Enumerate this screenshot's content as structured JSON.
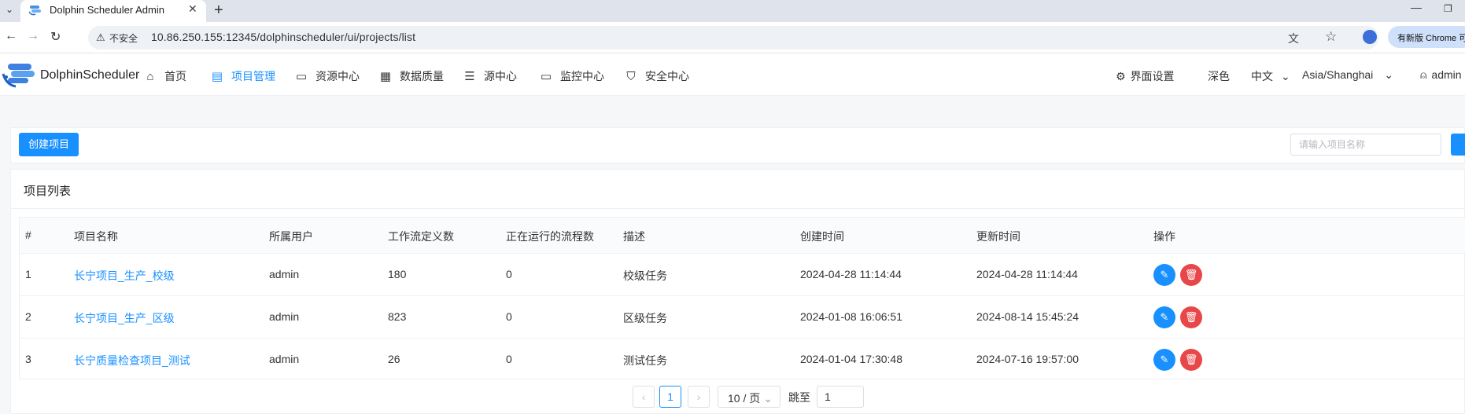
{
  "browser": {
    "tab_title": "Dolphin Scheduler Admin",
    "insecure_label": "不安全",
    "url": "10.86.250.155:12345/dolphinscheduler/ui/projects/list",
    "update_label": "有新版 Chrome 可"
  },
  "header": {
    "logo_text": "DolphinScheduler",
    "nav": [
      {
        "label": "首页",
        "icon": "home-icon"
      },
      {
        "label": "项目管理",
        "icon": "project-icon"
      },
      {
        "label": "资源中心",
        "icon": "folder-icon"
      },
      {
        "label": "数据质量",
        "icon": "document-icon"
      },
      {
        "label": "源中心",
        "icon": "database-icon"
      },
      {
        "label": "监控中心",
        "icon": "monitor-icon"
      },
      {
        "label": "安全中心",
        "icon": "shield-icon"
      }
    ],
    "settings_label": "界面设置",
    "theme_label": "深色",
    "language_label": "中文",
    "timezone_label": "Asia/Shanghai",
    "user_label": "admin"
  },
  "toolbar": {
    "create_label": "创建项目",
    "search_placeholder": "请输入项目名称"
  },
  "list": {
    "title": "项目列表",
    "columns": [
      "#",
      "项目名称",
      "所属用户",
      "工作流定义数",
      "正在运行的流程数",
      "描述",
      "创建时间",
      "更新时间",
      "操作"
    ],
    "rows": [
      {
        "index": "1",
        "name": "长宁项目_生产_校级",
        "owner": "admin",
        "workflow_count": "180",
        "running_count": "0",
        "description": "校级任务",
        "created": "2024-04-28 11:14:44",
        "updated": "2024-04-28 11:14:44"
      },
      {
        "index": "2",
        "name": "长宁项目_生产_区级",
        "owner": "admin",
        "workflow_count": "823",
        "running_count": "0",
        "description": "区级任务",
        "created": "2024-01-08 16:06:51",
        "updated": "2024-08-14 15:45:24"
      },
      {
        "index": "3",
        "name": "长宁质量检查项目_测试",
        "owner": "admin",
        "workflow_count": "26",
        "running_count": "0",
        "description": "测试任务",
        "created": "2024-01-04 17:30:48",
        "updated": "2024-07-16 19:57:00"
      }
    ]
  },
  "pagination": {
    "current_page": "1",
    "page_size": "10 / 页",
    "jump_label": "跳至",
    "jump_value": "1"
  },
  "colors": {
    "primary": "#1890ff",
    "danger": "#e8474a"
  }
}
